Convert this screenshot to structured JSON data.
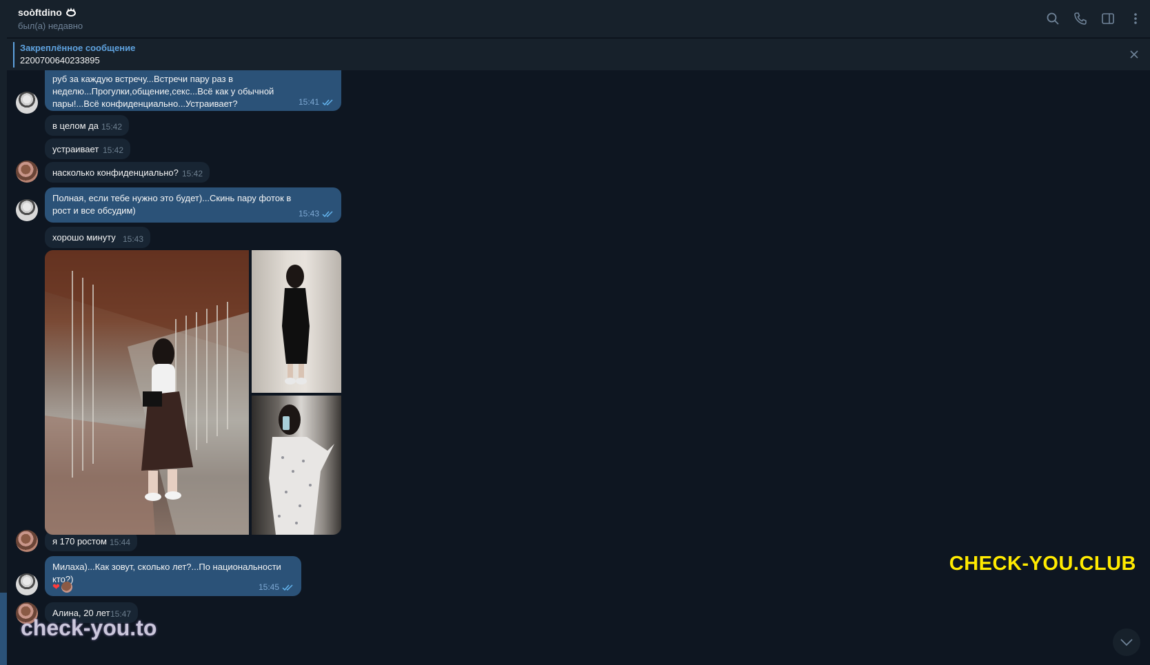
{
  "header": {
    "name": "soòftdino",
    "status": "был(а) недавно",
    "icons": [
      "search-icon",
      "phone-icon",
      "sidebar-toggle-icon",
      "more-vertical-icon"
    ]
  },
  "pinned": {
    "title": "Закреплённое сообщение",
    "text": "2200700640233895"
  },
  "messages": [
    {
      "type": "out",
      "text": "руб за каждую встречу...Встречи пару раз в неделю...Прогулки,общение,секс...Всё как у обычной пары!...Всё конфиденциально...Устраивает?",
      "time": "15:41",
      "read": true
    },
    {
      "type": "in",
      "text": "в целом да",
      "time": "15:42"
    },
    {
      "type": "in",
      "text": "устраивает",
      "time": "15:42"
    },
    {
      "type": "in",
      "text": "насколько конфиденциально?",
      "time": "15:42"
    },
    {
      "type": "out",
      "text": "Полная, если тебе нужно это будет)...Скинь пару фоток в рост и все обсудим)",
      "time": "15:43",
      "read": true
    },
    {
      "type": "in",
      "text": "хорошо минуту",
      "time": "15:43"
    },
    {
      "type": "in",
      "text": "я 170 ростом",
      "time": "15:44"
    },
    {
      "type": "out",
      "text": "Милаха)...Как зовут, сколько лет?...По национальности кто?)",
      "time": "15:45",
      "read": true,
      "reaction": "❤"
    },
    {
      "type": "in",
      "text": "Алина, 20 лет",
      "time": "15:47"
    }
  ],
  "watermarks": {
    "right": "CHECK-YOU.CLUB",
    "left": "check-you.to"
  },
  "colors": {
    "background": "#0e1621",
    "header": "#17212b",
    "incoming": "#182533",
    "outgoing": "#2b5278",
    "accent": "#5fa3e0",
    "watermark_yellow": "#ffea00"
  }
}
